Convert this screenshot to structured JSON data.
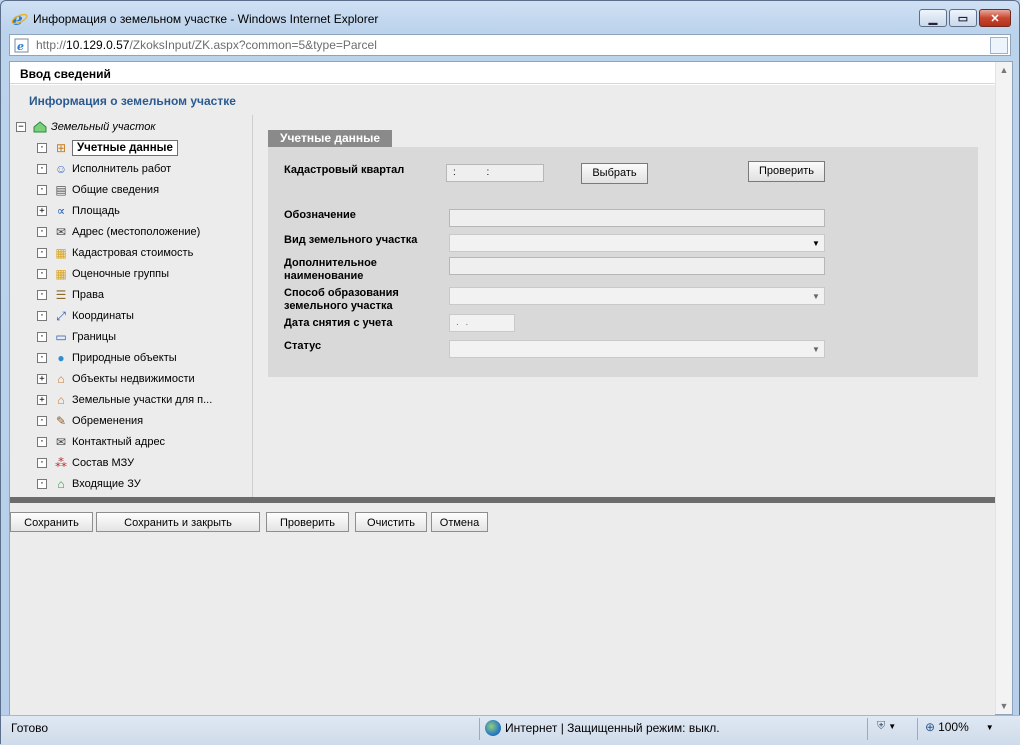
{
  "window": {
    "title": "Информация о земельном участке - Windows Internet Explorer",
    "url_prefix": "http://",
    "url_host": "10.129.0.57",
    "url_path": "/ZkoksInput/ZK.aspx?common=5&type=Parcel"
  },
  "page": {
    "header": "Ввод сведений",
    "subheader": "Информация о земельном участке"
  },
  "tree": {
    "root": "Земельный участок",
    "items": [
      {
        "label": "Учетные данные",
        "toggle": "·",
        "icon": "grid-icon",
        "selected": true
      },
      {
        "label": "Исполнитель работ",
        "toggle": "·",
        "icon": "person-icon"
      },
      {
        "label": "Общие сведения",
        "toggle": "·",
        "icon": "document-icon"
      },
      {
        "label": "Площадь",
        "toggle": "+",
        "icon": "formula-icon"
      },
      {
        "label": "Адрес (местоположение)",
        "toggle": "·",
        "icon": "address-icon"
      },
      {
        "label": "Кадастровая стоимость",
        "toggle": "·",
        "icon": "coins-icon"
      },
      {
        "label": "Оценочные группы",
        "toggle": "·",
        "icon": "coins-icon"
      },
      {
        "label": "Права",
        "toggle": "·",
        "icon": "list-icon"
      },
      {
        "label": "Координаты",
        "toggle": "·",
        "icon": "xy-icon"
      },
      {
        "label": "Границы",
        "toggle": "·",
        "icon": "border-icon"
      },
      {
        "label": "Природные объекты",
        "toggle": "·",
        "icon": "globe-icon"
      },
      {
        "label": "Объекты недвижимости",
        "toggle": "+",
        "icon": "house-icon"
      },
      {
        "label": "Земельные участки для п...",
        "toggle": "+",
        "icon": "house-icon"
      },
      {
        "label": "Обременения",
        "toggle": "·",
        "icon": "scroll-icon"
      },
      {
        "label": "Контактный адрес",
        "toggle": "·",
        "icon": "address-icon"
      },
      {
        "label": "Состав МЗУ",
        "toggle": "·",
        "icon": "composition-icon"
      },
      {
        "label": "Входящие ЗУ",
        "toggle": "·",
        "icon": "parcel-icon"
      }
    ]
  },
  "form": {
    "tab": "Учетные данные",
    "cadastral_quarter": {
      "label": "Кадастровый квартал",
      "value": ":      :"
    },
    "select_button": "Выбрать",
    "check_button": "Проверить",
    "designation": {
      "label": "Обозначение",
      "value": ""
    },
    "parcel_type": {
      "label": "Вид земельного участка",
      "value": ""
    },
    "extra_name": {
      "label": "Дополнительное наименование",
      "value": ""
    },
    "formation_method": {
      "label": "Способ образования земельного участка",
      "value": ""
    },
    "removal_date": {
      "label": "Дата снятия с учета",
      "value": ".   ."
    },
    "status": {
      "label": "Статус",
      "value": ""
    }
  },
  "footer": {
    "save": "Сохранить",
    "save_close": "Сохранить и закрыть",
    "check": "Проверить",
    "clear": "Очистить",
    "cancel": "Отмена"
  },
  "statusbar": {
    "ready": "Готово",
    "zone": "Интернет | Защищенный режим: выкл.",
    "zoom": "100%"
  }
}
